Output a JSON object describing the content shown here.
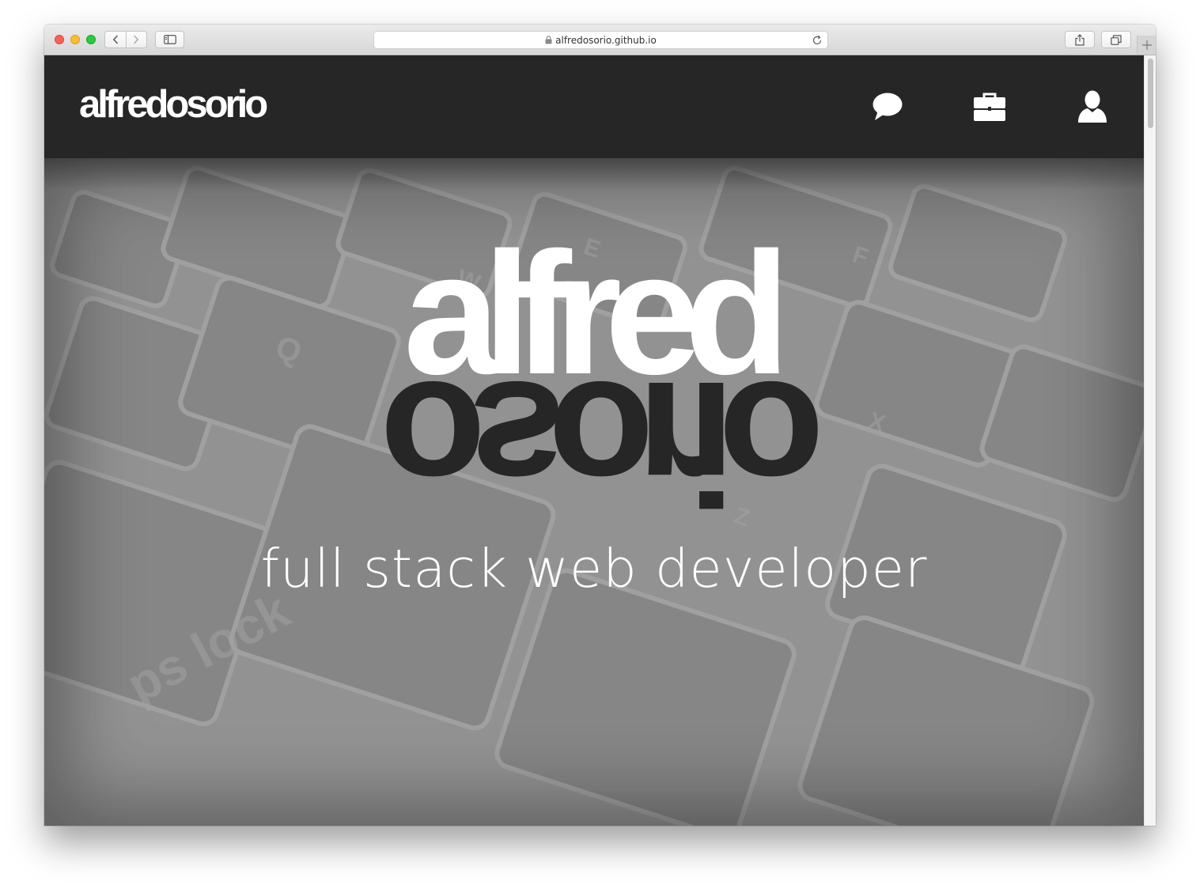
{
  "browser": {
    "url": "alfredosorio.github.io",
    "icons": {
      "back": "chevron-left-icon",
      "forward": "chevron-right-icon",
      "sidebar": "sidebar-icon",
      "lock": "lock-icon",
      "reload": "reload-icon",
      "share": "share-icon",
      "tabs": "tabs-icon",
      "new_tab": "plus-icon"
    }
  },
  "header": {
    "brand": "alfredosorio",
    "background_color": "#262626",
    "nav": [
      {
        "icon": "chat-bubble-icon"
      },
      {
        "icon": "briefcase-icon"
      },
      {
        "icon": "user-icon"
      }
    ]
  },
  "hero": {
    "logo_first": "alfred",
    "logo_last": "osorio",
    "tagline": "full stack web developer"
  },
  "colors": {
    "accent_dark": "#262626",
    "text_light": "#ffffff",
    "hero_overlay": "#8d8d8d"
  }
}
